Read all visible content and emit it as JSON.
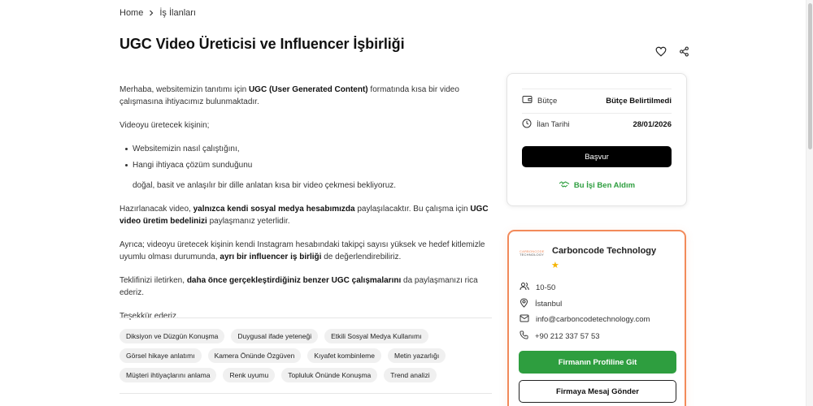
{
  "breadcrumb": {
    "home": "Home",
    "current": "İş İlanları"
  },
  "title": "UGC Video Üreticisi ve Influencer İşbirliği",
  "description": {
    "p1_a": "Merhaba, websitemizin tanıtımı için ",
    "p1_b": "UGC (User Generated Content)",
    "p1_c": " formatında kısa bir video çalışmasına ihtiyacımız bulunmaktadır.",
    "p2": "Videoyu üretecek kişinin;",
    "bullets": [
      "Websitemizin nasıl çalıştığını,",
      "Hangi ihtiyaca çözüm sunduğunu"
    ],
    "bullet_cont": "doğal, basit ve anlaşılır bir dille anlatan kısa bir video çekmesi bekliyoruz.",
    "p3_a": "Hazırlanacak video, ",
    "p3_b": "yalnızca kendi sosyal medya hesabımızda",
    "p3_c": " paylaşılacaktır. Bu çalışma için ",
    "p3_d": "UGC video üretim bedelinizi",
    "p3_e": " paylaşmanız yeterlidir.",
    "p4_a": "Ayrıca; videoyu üretecek kişinin kendi Instagram hesabındaki takipçi sayısı yüksek ve hedef kitlemizle uyumlu olması durumunda, ",
    "p4_b": "ayrı bir influencer iş birliği",
    "p4_c": " de değerlendirebiliriz.",
    "p5_a": "Teklifinizi iletirken, ",
    "p5_b": "daha önce gerçekleştirdiğiniz benzer UGC çalışmalarını",
    "p5_c": " da paylaşmanızı rica ederiz.",
    "p6": "Teşekkür ederiz."
  },
  "tags": [
    "Diksiyon ve Düzgün Konuşma",
    "Duygusal ifade yeteneği",
    "Etkili Sosyal Medya Kullanımı",
    "Görsel hikaye anlatımı",
    "Kamera Önünde Özgüven",
    "Kıyafet kombinleme",
    "Metin yazarlığı",
    "Müşteri ihtiyaçlarını anlama",
    "Renk uyumu",
    "Topluluk Önünde Konuşma",
    "Trend analizi"
  ],
  "job": {
    "budget_label": "Bütçe",
    "budget_value": "Bütçe Belirtilmedi",
    "date_label": "İlan Tarihi",
    "date_value": "28/01/2026",
    "apply_label": "Başvur",
    "took_label": "Bu İşi Ben Aldım"
  },
  "company": {
    "logo_line1": "CARBONCODE",
    "logo_line2": "TECHNOLOGY",
    "name": "Carboncode Technology",
    "employees": "10-50",
    "city": "İstanbul",
    "email": "info@carboncodetechnology.com",
    "phone": "+90 212 337 57 53",
    "profile_label": "Firmanın Profiline Git",
    "message_label": "Firmaya Mesaj Gönder"
  },
  "colors": {
    "accent_green": "#2e9e3f",
    "card_border": "#f28a5a",
    "star": "#f5b400"
  },
  "icons": [
    "chevron-right-icon",
    "heart-icon",
    "share-icon",
    "wallet-icon",
    "clock-icon",
    "handshake-icon",
    "users-icon",
    "location-icon",
    "mail-icon",
    "phone-icon",
    "star-icon"
  ]
}
